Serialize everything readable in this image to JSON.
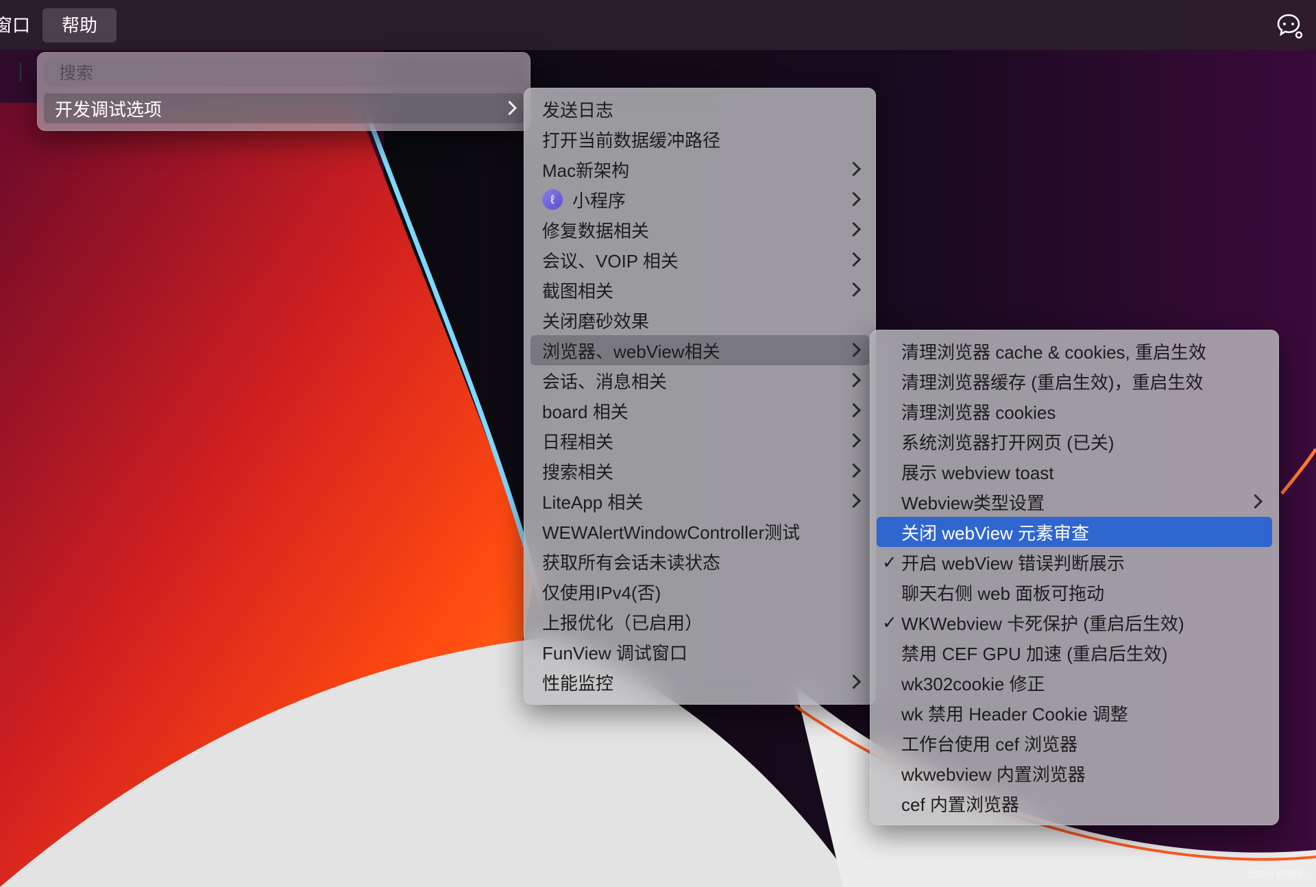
{
  "menubar": {
    "items": [
      "窗口",
      "帮助"
    ],
    "right_icon": "wechat-chat-icon"
  },
  "root_menu": {
    "search_placeholder": "搜索",
    "items": [
      {
        "label": "开发调试选项",
        "submenu": true
      }
    ]
  },
  "debug_menu": {
    "items": [
      {
        "label": "发送日志",
        "submenu": false
      },
      {
        "label": "打开当前数据缓冲路径",
        "submenu": false
      },
      {
        "label": "Mac新架构",
        "submenu": true
      },
      {
        "label": "小程序",
        "submenu": true,
        "icon": "miniprogram-icon"
      },
      {
        "label": "修复数据相关",
        "submenu": true
      },
      {
        "label": "会议、VOIP 相关",
        "submenu": true
      },
      {
        "label": "截图相关",
        "submenu": true
      },
      {
        "label": "关闭磨砂效果",
        "submenu": false
      },
      {
        "label": "浏览器、webView相关",
        "submenu": true
      },
      {
        "label": "会话、消息相关",
        "submenu": true
      },
      {
        "label": "board 相关",
        "submenu": true
      },
      {
        "label": "日程相关",
        "submenu": true
      },
      {
        "label": "搜索相关",
        "submenu": true
      },
      {
        "label": "LiteApp 相关",
        "submenu": true
      },
      {
        "label": "WEWAlertWindowController测试",
        "submenu": false
      },
      {
        "label": "获取所有会话未读状态",
        "submenu": false
      },
      {
        "label": "仅使用IPv4(否)",
        "submenu": false
      },
      {
        "label": "上报优化（已启用）",
        "submenu": false
      },
      {
        "label": "FunView 调试窗口",
        "submenu": false
      },
      {
        "label": "性能监控",
        "submenu": true
      }
    ]
  },
  "webview_menu": {
    "items": [
      {
        "label": "清理浏览器 cache & cookies, 重启生效",
        "checked": false,
        "submenu": false
      },
      {
        "label": "清理浏览器缓存 (重启生效)，重启生效",
        "checked": false,
        "submenu": false
      },
      {
        "label": "清理浏览器 cookies",
        "checked": false,
        "submenu": false
      },
      {
        "label": "系统浏览器打开网页 (已关)",
        "checked": false,
        "submenu": false
      },
      {
        "label": "展示 webview toast",
        "checked": false,
        "submenu": false
      },
      {
        "label": "Webview类型设置",
        "checked": false,
        "submenu": true
      },
      {
        "label": "关闭 webView 元素审查",
        "checked": false,
        "submenu": false
      },
      {
        "label": "开启 webView 错误判断展示",
        "checked": true,
        "submenu": false
      },
      {
        "label": "聊天右侧 web 面板可拖动",
        "checked": false,
        "submenu": false
      },
      {
        "label": "WKWebview 卡死保护 (重启后生效)",
        "checked": true,
        "submenu": false
      },
      {
        "label": "禁用 CEF GPU 加速 (重启后生效)",
        "checked": false,
        "submenu": false
      },
      {
        "label": "wk302cookie 修正",
        "checked": false,
        "submenu": false
      },
      {
        "label": "wk 禁用 Header Cookie 调整",
        "checked": false,
        "submenu": false
      },
      {
        "label": "工作台使用 cef 浏览器",
        "checked": false,
        "submenu": false
      },
      {
        "label": "wkwebview 内置浏览器",
        "checked": false,
        "submenu": false
      },
      {
        "label": "cef 内置浏览器",
        "checked": false,
        "submenu": false
      }
    ]
  },
  "check_glyph": "✓",
  "icon_glyphs": {
    "miniprogram": "ℓ"
  },
  "watermark": "CSDN @旭仔_",
  "colors": {
    "highlight_blue": "#2f66cf",
    "menubar_bg": "#2c1e2c"
  }
}
